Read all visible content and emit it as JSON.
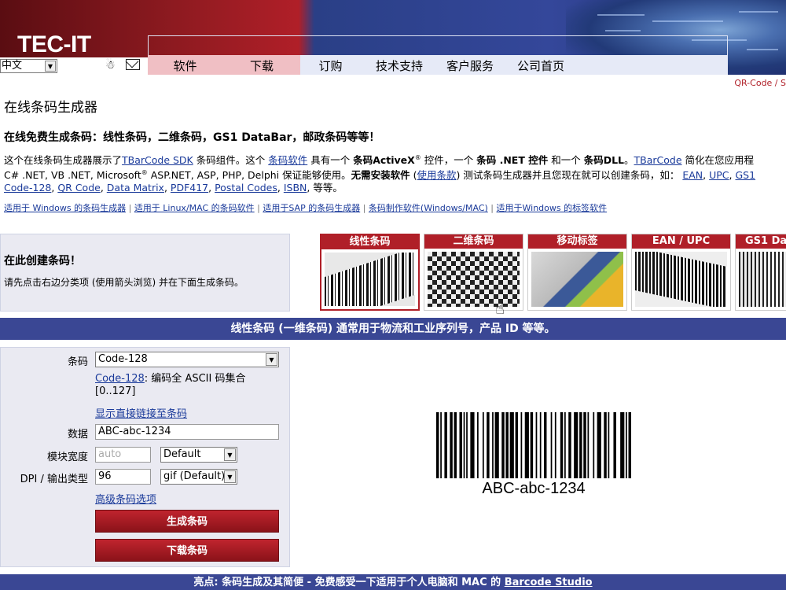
{
  "header": {
    "logo": "TEC-IT",
    "language": "中文",
    "nav": [
      "软件",
      "下载",
      "订购",
      "技术支持",
      "客户服务",
      "公司首页"
    ],
    "qr_link": "QR-Code / S"
  },
  "page": {
    "title": "在线条码生成器",
    "subtitle": "在线免费生成条码：线性条码，二维条码，GS1 DataBar，邮政条码等等！",
    "intro": {
      "p1": "这个在线条码生成器展示了",
      "l_tbarcode_sdk": "TBarCode SDK",
      "p2": " 条码组件。这个 ",
      "l_barcode_software": "条码软件",
      "p3": " 具有一个 ",
      "b_activex": "条码ActiveX",
      "p4": " 控件，一个 ",
      "b_net": "条码 .NET 控件",
      "p5": " 和一个 ",
      "b_dll": "条码DLL",
      "p6": "。",
      "l_tbarcode": "TBarCode",
      "p7": " 简化在您应用程",
      "p8": "C# .NET, VB .NET, Microsoft",
      "p9": " ASP.NET, ASP, PHP, Delphi 保证能够使用。",
      "b_noinstall": "无需安装软件",
      "p10": " (",
      "l_use_terms": "使用条款",
      "p11": ") 测试条码生成器并且您现在就可以创建条码，如：",
      "l_ean": "EAN",
      "l_upc": "UPC",
      "l_gs1": "GS1",
      "l_code128": "Code-128",
      "l_qr": "QR Code",
      "l_dm": "Data Matrix",
      "l_pdf417": "PDF417",
      "l_postal": "Postal Codes",
      "l_isbn": "ISBN",
      "p12": ", 等等。"
    },
    "links": [
      "适用于 Windows 的条码生成器",
      "适用于 Linux/MAC 的条码软件",
      "适用于SAP 的条码生成器",
      "条码制作软件(Windows/MAC)",
      "适用于Windows 的标签软件"
    ]
  },
  "create": {
    "title": "在此创建条码！",
    "desc": "请先点击右边分类项 (使用箭头浏览) 并在下面生成条码。"
  },
  "tiles": [
    "线性条码",
    "二维条码",
    "移动标签",
    "EAN / UPC",
    "GS1 Da"
  ],
  "band": "线性条码 (一维条码) 通常用于物流和工业序列号，产品 ID 等等。",
  "form": {
    "symbology_label": "条码",
    "symbology_value": "Code-128",
    "symbology_link": "Code-128",
    "symbology_desc": ": 编码全 ASCII 码集合 [0..127]",
    "direct_link": "显示直接链接至条码",
    "data_label": "数据",
    "data_value": "ABC-abc-1234",
    "module_label": "模块宽度",
    "module_placeholder": "auto",
    "module_select": "Default",
    "dpi_label": "DPI / 输出类型",
    "dpi_value": "96",
    "type_select": "gif (Default)",
    "advanced_link": "高级条码选项",
    "generate_button": "生成条码",
    "download_button": "下载条码"
  },
  "barcode": {
    "text": "ABC-abc-1234",
    "pattern": [
      2,
      1,
      1,
      2,
      2,
      2,
      2,
      1,
      2,
      2,
      2,
      1,
      1,
      1,
      1,
      2,
      3,
      2,
      1,
      3,
      1,
      2,
      2,
      2,
      1,
      1,
      3,
      2,
      2,
      1,
      2,
      1,
      3,
      1,
      2,
      2,
      1,
      2,
      3,
      1,
      2,
      2,
      1,
      2,
      1,
      2,
      2,
      3,
      1,
      2,
      1,
      3,
      2,
      1,
      1,
      2,
      2,
      2,
      3,
      1,
      2,
      1,
      2,
      1,
      1,
      3,
      1,
      2,
      3,
      2,
      2,
      1,
      1,
      3,
      2,
      3,
      3,
      1,
      1,
      1,
      2
    ]
  },
  "footer": {
    "text": "亮点: 条码生成及其简便 - 免费感受一下适用于个人电脑和 MAC 的 ",
    "link": "Barcode Studio"
  },
  "colors": {
    "brand_red": "#b01f28",
    "band_blue": "#3a4794",
    "link_blue": "#1a3a9a"
  }
}
